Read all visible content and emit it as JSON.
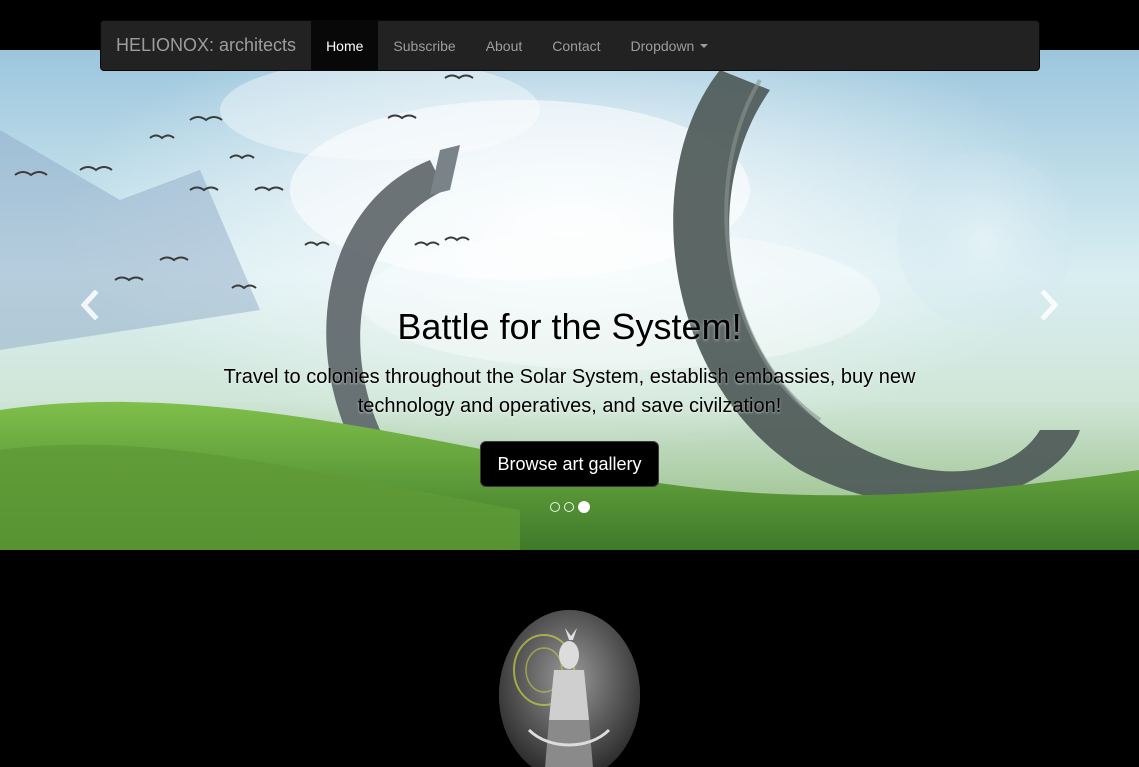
{
  "navbar": {
    "brand": "HELIONOX: architects",
    "items": [
      {
        "label": "Home",
        "active": true
      },
      {
        "label": "Subscribe",
        "active": false
      },
      {
        "label": "About",
        "active": false
      },
      {
        "label": "Contact",
        "active": false
      },
      {
        "label": "Dropdown",
        "active": false,
        "has_caret": true
      }
    ]
  },
  "carousel": {
    "heading": "Battle for the System!",
    "text": "Travel to colonies throughout the Solar System, establish embassies, buy new technology and operatives, and save civilzation!",
    "button_label": "Browse art gallery",
    "indicators": 3,
    "active_indicator": 3,
    "prev_icon": "chevron-left-icon",
    "next_icon": "chevron-right-icon"
  },
  "colors": {
    "navbar_bg": "#222222",
    "nav_text": "#9d9d9d",
    "nav_active_bg": "#080808",
    "page_bg": "#000000",
    "button_bg": "#000000"
  }
}
